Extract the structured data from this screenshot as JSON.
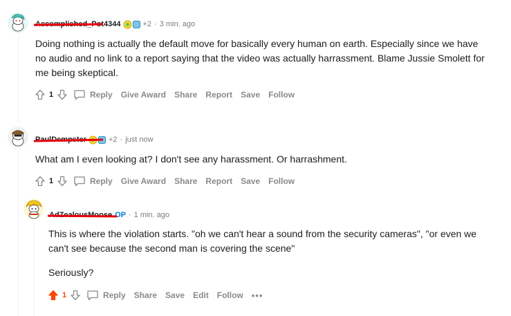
{
  "comments": [
    {
      "username": "Accomplished_Pot4344",
      "awards": "+2",
      "time": "3 min. ago",
      "body": [
        "Doing nothing is actually the default move for basically every human on earth. Especially since we have no audio and no link to a report saying that the video was actually harrassment. Blame Jussie Smolett for me being skeptical."
      ],
      "score": "1",
      "actions": [
        "Reply",
        "Give Award",
        "Share",
        "Report",
        "Save",
        "Follow"
      ]
    },
    {
      "username": "PaulDempster",
      "awards": "+2",
      "time": "just now",
      "body": [
        "What am I even looking at? I don't see any harassment. Or harrashment."
      ],
      "score": "1",
      "actions": [
        "Reply",
        "Give Award",
        "Share",
        "Report",
        "Save",
        "Follow"
      ]
    },
    {
      "username": "AdZealousMoose",
      "op_badge": "OP",
      "time": "1 min. ago",
      "body": [
        "This is where the violation starts. \"oh we can't hear a sound from the security cameras\", \"or even we can't see because the second man is covering the scene\"",
        "Seriously?"
      ],
      "score": "1",
      "actions": [
        "Reply",
        "Share",
        "Save",
        "Edit",
        "Follow"
      ],
      "more": "•••"
    }
  ],
  "colors": {
    "upvoted": "#ff4500",
    "op": "#0079d3",
    "muted": "#878a8c",
    "redaction": "#e8000b"
  }
}
